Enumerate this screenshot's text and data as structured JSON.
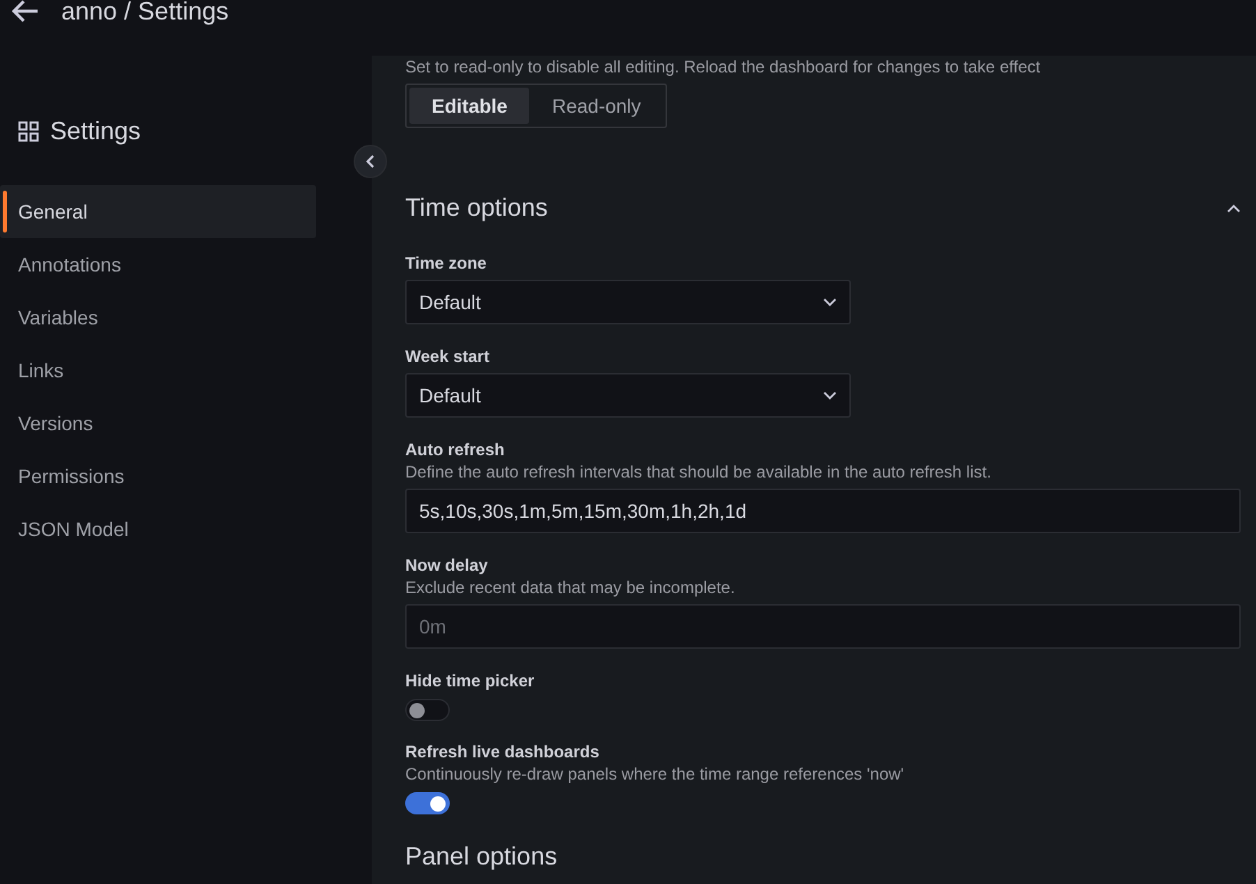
{
  "header": {
    "title": "anno / Settings"
  },
  "sidebar": {
    "title": "Settings",
    "items": [
      {
        "label": "General",
        "selected": true
      },
      {
        "label": "Annotations",
        "selected": false
      },
      {
        "label": "Variables",
        "selected": false
      },
      {
        "label": "Links",
        "selected": false
      },
      {
        "label": "Versions",
        "selected": false
      },
      {
        "label": "Permissions",
        "selected": false
      },
      {
        "label": "JSON Model",
        "selected": false
      }
    ]
  },
  "editable": {
    "description": "Set to read-only to disable all editing. Reload the dashboard for changes to take effect",
    "options": [
      {
        "label": "Editable",
        "selected": true
      },
      {
        "label": "Read-only",
        "selected": false
      }
    ]
  },
  "time_options": {
    "title": "Time options",
    "expanded": true,
    "fields": [
      {
        "kind": "select",
        "label": "Time zone",
        "value": "Default"
      },
      {
        "kind": "select",
        "label": "Week start",
        "value": "Default"
      },
      {
        "kind": "input",
        "label": "Auto refresh",
        "description": "Define the auto refresh intervals that should be available in the auto refresh list.",
        "value": "5s,10s,30s,1m,5m,15m,30m,1h,2h,1d"
      },
      {
        "kind": "input",
        "label": "Now delay",
        "description": "Exclude recent data that may be incomplete.",
        "placeholder": "0m"
      },
      {
        "kind": "switch",
        "label": "Hide time picker",
        "on": false
      },
      {
        "kind": "switch",
        "label": "Refresh live dashboards",
        "description": "Continuously re-draw panels where the time range references 'now'",
        "on": true
      }
    ]
  },
  "next_section": {
    "title": "Panel options"
  }
}
